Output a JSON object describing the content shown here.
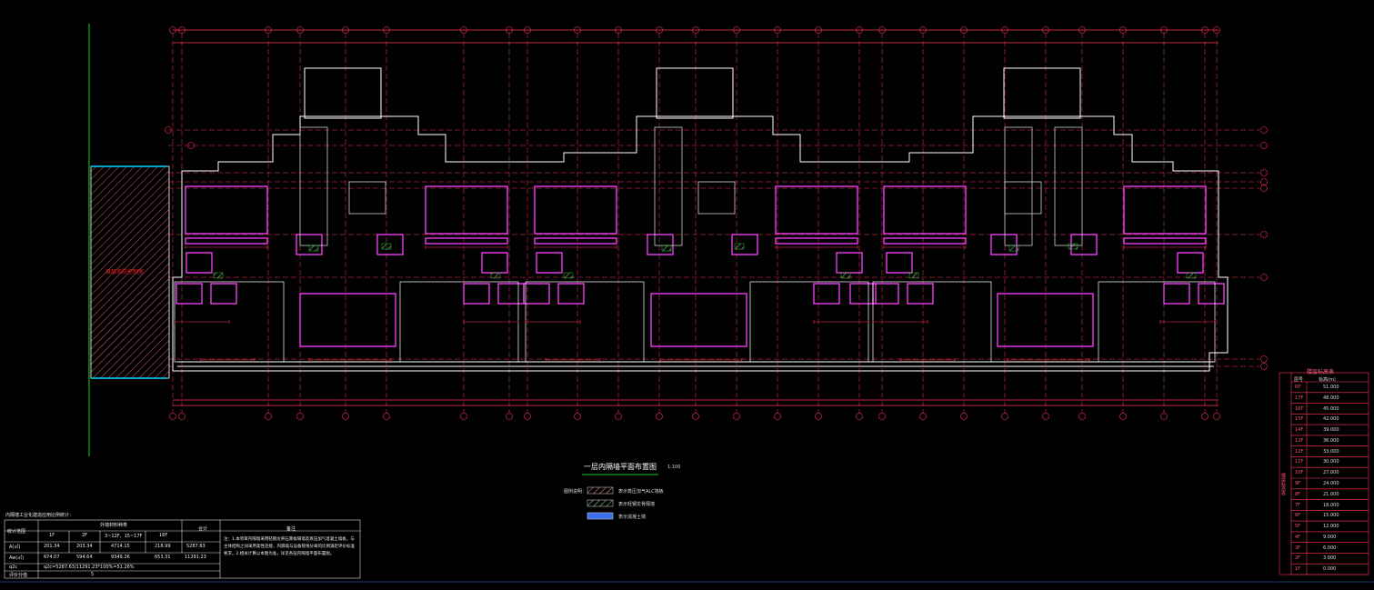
{
  "drawing": {
    "title": "一层内隔墙平面布置图",
    "scale": "1:100",
    "fire_room_label": "首层消防控制室"
  },
  "legend": {
    "heading": "图例说明：",
    "items": [
      {
        "label": "表示蒸压加气ALC墙板",
        "color": "#e08a8a"
      },
      {
        "label": "表示轻钢龙骨隔墙",
        "color": "#7ac98a"
      },
      {
        "label": "表示混凝土墙",
        "color": "#3a6ee8"
      }
    ]
  },
  "stats_table": {
    "caption": "内隔墙工业化建造应用比例统计：",
    "header_row1": [
      "统计范围",
      "外墙材料种类",
      "",
      "",
      "",
      "合计",
      "备注"
    ],
    "header_row2": [
      "",
      "1F",
      "2F",
      "3~12F、15~17F",
      "16F",
      "",
      ""
    ],
    "rows": [
      [
        "A(㎡)",
        "201.34",
        "203.34",
        "4714.15",
        "218.99",
        "5287.63"
      ],
      [
        "Aw(㎡)",
        "674.07",
        "594.64",
        "9349.26",
        "653.31",
        "11291.23"
      ],
      [
        "q2c",
        "q2c=5287.63/11291.23*100%=51.26%",
        "",
        "",
        "",
        ""
      ],
      [
        "评价分值",
        "5",
        "",
        "",
        "",
        ""
      ]
    ],
    "note": "注：1.本项目内隔墙采用轻钢龙骨石膏板隔墙及蒸压加气混凝土墙板，与主体结构之间采用柔性连接，内隔墙与设备管线分离的比例满足评价标准要求。2.相关计算以本图为准，详见各层内隔墙平面布置图。"
  },
  "elevation_table": {
    "title": "楼层标高表",
    "col_header": [
      "层号",
      "标高(m)"
    ],
    "side_label": "楼层标高表",
    "rows": [
      [
        "RF",
        "51.000"
      ],
      [
        "17F",
        "48.000"
      ],
      [
        "16F",
        "45.000"
      ],
      [
        "15F",
        "42.000"
      ],
      [
        "14F",
        "39.000"
      ],
      [
        "13F",
        "36.000"
      ],
      [
        "12F",
        "33.000"
      ],
      [
        "11F",
        "30.000"
      ],
      [
        "10F",
        "27.000"
      ],
      [
        "9F",
        "24.000"
      ],
      [
        "8F",
        "21.000"
      ],
      [
        "7F",
        "18.000"
      ],
      [
        "6F",
        "15.000"
      ],
      [
        "5F",
        "12.000"
      ],
      [
        "4F",
        "9.000"
      ],
      [
        "3F",
        "6.000"
      ],
      [
        "2F",
        "3.000"
      ],
      [
        "1F",
        "0.000"
      ]
    ]
  },
  "colors": {
    "background": "#000000",
    "grid_line": "#ff3355",
    "dimension": "#ff3355",
    "wall": "#ffffff",
    "partition": "#ff40ff",
    "green_axis": "#22cc22",
    "cyan": "#00d8ff",
    "yellow": "#ffff00"
  }
}
